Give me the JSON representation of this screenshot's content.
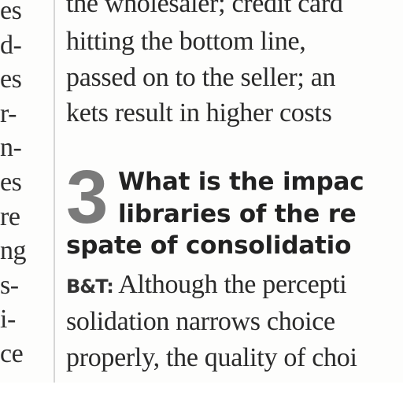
{
  "left_column": {
    "fragments": [
      "es",
      "d-",
      "es",
      "r-",
      "n-",
      "es",
      "re",
      "ng",
      "s-",
      "i-",
      "ce"
    ]
  },
  "right_column": {
    "top_lines": [
      "the wholesaler; credit card",
      "hitting the bottom line,",
      "passed on to the seller; an",
      "kets result in higher costs"
    ],
    "question": {
      "number": "3",
      "lines": [
        "What is the impac",
        "libraries of the re",
        "spate of consolidatio"
      ]
    },
    "answer": {
      "label": "B&T:",
      "first_line": "Although the percepti",
      "lines": [
        "solidation narrows choice",
        "properly, the quality of choi"
      ]
    }
  }
}
